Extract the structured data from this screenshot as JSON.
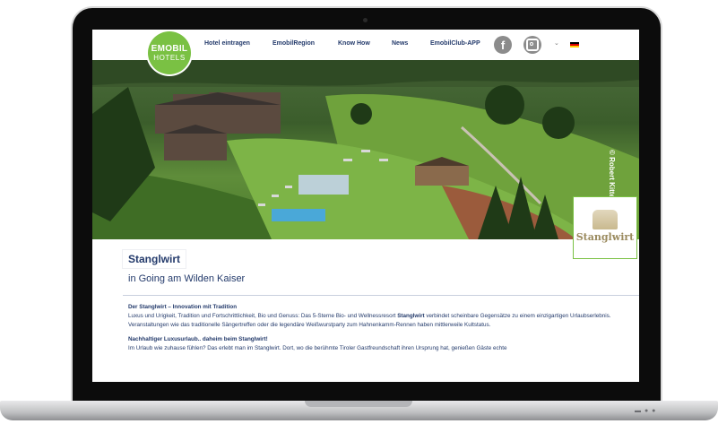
{
  "nav": {
    "logo_line1": "EMOBIL",
    "logo_line2": "HOTELS",
    "items": [
      "Hotel eintragen",
      "EmobilRegion",
      "Know How",
      "News",
      "EmobilClub-APP"
    ],
    "facebook_icon": "facebook-icon",
    "instagram_icon": "instagram-icon",
    "language_caret": "⌄",
    "language": "de-flag"
  },
  "hero": {
    "photo_credit": "© Robert Kittel",
    "brand_name": "Stanglwirt"
  },
  "page": {
    "title": "Stanglwirt",
    "subtitle": "in Going am Wilden Kaiser"
  },
  "content": {
    "heading1": "Der Stanglwirt – Innovation mit Tradition",
    "para1_a": "Luxus und Urigkeit, Tradition und Fortschrittlichkeit, Bio und Genuss: Das 5-Sterne Bio- und Wellnessresort ",
    "para1_bold": "Stanglwirt",
    "para1_b": " verbindet scheinbare Gegensätze zu einem einzigartigen Urlaubserlebnis. Veranstaltungen wie das traditionelle Sängertreffen oder die legendäre Weißwurstparty zum Hahnenkamm-Rennen haben mittlerweile Kultstatus.",
    "heading2": "Nachhaltiger Luxusurlaub.. daheim beim Stanglwirt!",
    "para2": "Im Urlaub wie zuhause fühlen? Das erlebt man im Stanglwirt. Dort, wo die berühmte Tiroler Gastfreundschaft ihren Ursprung hat, genießen Gäste echte"
  },
  "colors": {
    "brand_green": "#7ac143",
    "navy_text": "#233a6b"
  }
}
